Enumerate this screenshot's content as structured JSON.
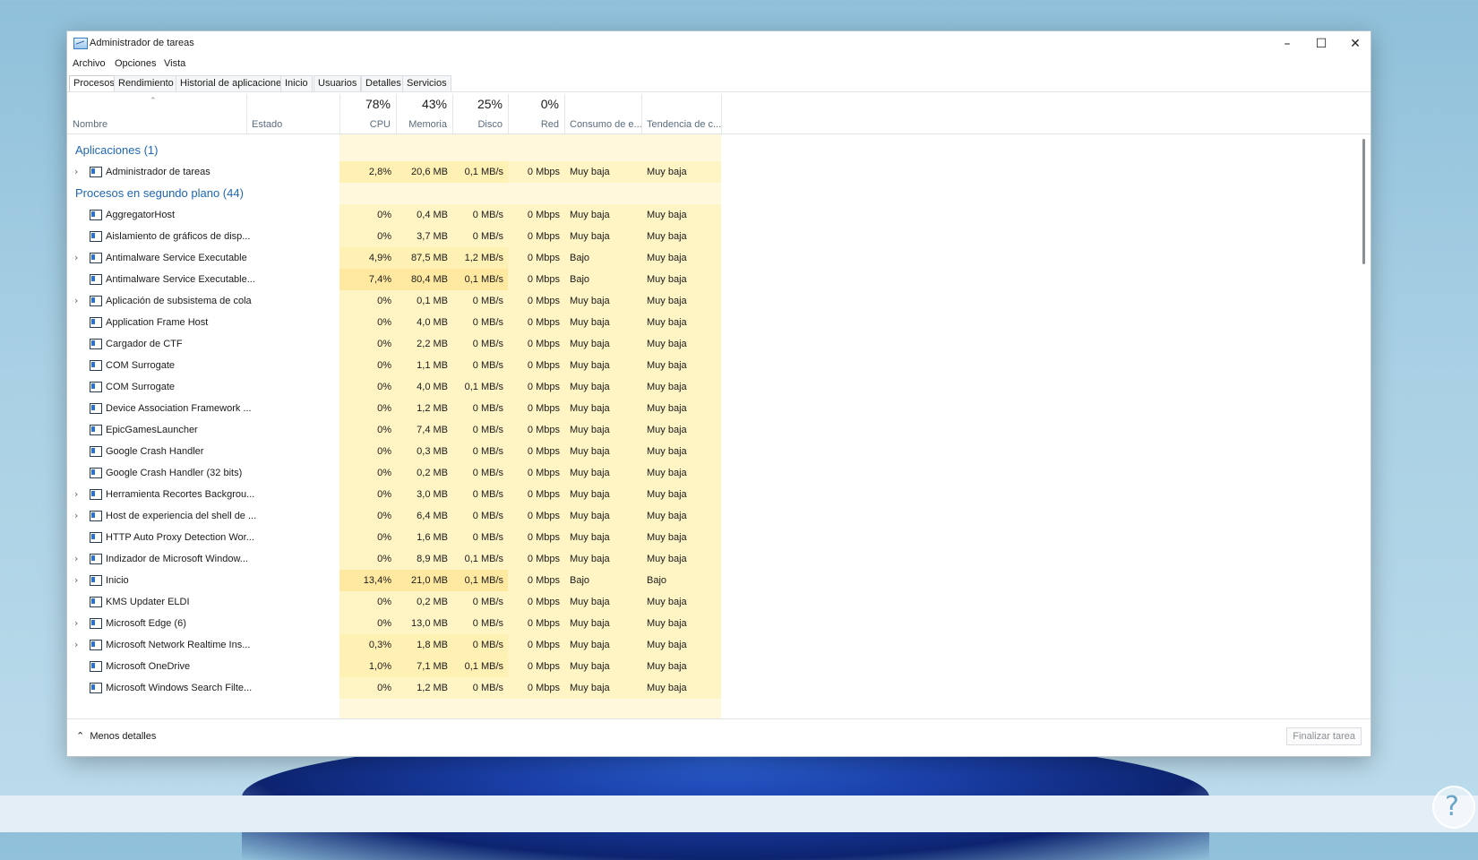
{
  "window": {
    "title": "Administrador de tareas",
    "controls": {
      "minimize": "–",
      "maximize": "☐",
      "close": "✕"
    }
  },
  "menu": [
    "Archivo",
    "Opciones",
    "Vista"
  ],
  "tabs": [
    "Procesos",
    "Rendimiento",
    "Historial de aplicaciones",
    "Inicio",
    "Usuarios",
    "Detalles",
    "Servicios"
  ],
  "active_tab": "Procesos",
  "columns": {
    "name": "Nombre",
    "status": "Estado",
    "cpu": {
      "pct": "78%",
      "label": "CPU"
    },
    "mem": {
      "pct": "43%",
      "label": "Memoria"
    },
    "disk": {
      "pct": "25%",
      "label": "Disco"
    },
    "net": {
      "pct": "0%",
      "label": "Red"
    },
    "power": "Consumo de e...",
    "trend": "Tendencia de c..."
  },
  "groups": {
    "apps": "Aplicaciones (1)",
    "background": "Procesos en segundo plano (44)"
  },
  "apps": [
    {
      "name": "Administrador de tareas",
      "expand": true,
      "icon": "task-manager-icon",
      "cpu": "2,8%",
      "mem": "20,6 MB",
      "disk": "0,1 MB/s",
      "net": "0 Mbps",
      "power": "Muy baja",
      "trend": "Muy baja"
    }
  ],
  "background": [
    {
      "name": "AggregatorHost",
      "expand": false,
      "icon": "window-process-icon",
      "cpu": "0%",
      "mem": "0,4 MB",
      "disk": "0 MB/s",
      "net": "0 Mbps",
      "power": "Muy baja",
      "trend": "Muy baja"
    },
    {
      "name": "Aislamiento de gráficos de disp...",
      "expand": false,
      "icon": "window-process-icon",
      "cpu": "0%",
      "mem": "3,7 MB",
      "disk": "0 MB/s",
      "net": "0 Mbps",
      "power": "Muy baja",
      "trend": "Muy baja"
    },
    {
      "name": "Antimalware Service Executable",
      "expand": true,
      "icon": "window-process-icon",
      "cpu": "4,9%",
      "mem": "87,5 MB",
      "disk": "1,2 MB/s",
      "net": "0 Mbps",
      "power": "Bajo",
      "trend": "Muy baja"
    },
    {
      "name": "Antimalware Service Executable...",
      "expand": false,
      "icon": "window-process-icon",
      "cpu": "7,4%",
      "mem": "80,4 MB",
      "disk": "0,1 MB/s",
      "net": "0 Mbps",
      "power": "Bajo",
      "trend": "Muy baja"
    },
    {
      "name": "Aplicación de subsistema de cola",
      "expand": true,
      "icon": "printer-icon",
      "cpu": "0%",
      "mem": "0,1 MB",
      "disk": "0 MB/s",
      "net": "0 Mbps",
      "power": "Muy baja",
      "trend": "Muy baja"
    },
    {
      "name": "Application Frame Host",
      "expand": false,
      "icon": "window-process-icon",
      "cpu": "0%",
      "mem": "4,0 MB",
      "disk": "0 MB/s",
      "net": "0 Mbps",
      "power": "Muy baja",
      "trend": "Muy baja"
    },
    {
      "name": "Cargador de CTF",
      "expand": false,
      "icon": "pen-icon",
      "cpu": "0%",
      "mem": "2,2 MB",
      "disk": "0 MB/s",
      "net": "0 Mbps",
      "power": "Muy baja",
      "trend": "Muy baja"
    },
    {
      "name": "COM Surrogate",
      "expand": false,
      "icon": "window-process-icon",
      "cpu": "0%",
      "mem": "1,1 MB",
      "disk": "0 MB/s",
      "net": "0 Mbps",
      "power": "Muy baja",
      "trend": "Muy baja"
    },
    {
      "name": "COM Surrogate",
      "expand": false,
      "icon": "window-process-icon",
      "cpu": "0%",
      "mem": "4,0 MB",
      "disk": "0,1 MB/s",
      "net": "0 Mbps",
      "power": "Muy baja",
      "trend": "Muy baja"
    },
    {
      "name": "Device Association Framework ...",
      "expand": false,
      "icon": "window-process-icon",
      "cpu": "0%",
      "mem": "1,2 MB",
      "disk": "0 MB/s",
      "net": "0 Mbps",
      "power": "Muy baja",
      "trend": "Muy baja"
    },
    {
      "name": "EpicGamesLauncher",
      "expand": false,
      "icon": "epic-games-icon",
      "cpu": "0%",
      "mem": "7,4 MB",
      "disk": "0 MB/s",
      "net": "0 Mbps",
      "power": "Muy baja",
      "trend": "Muy baja"
    },
    {
      "name": "Google Crash Handler",
      "expand": false,
      "icon": "google-update-icon",
      "cpu": "0%",
      "mem": "0,3 MB",
      "disk": "0 MB/s",
      "net": "0 Mbps",
      "power": "Muy baja",
      "trend": "Muy baja"
    },
    {
      "name": "Google Crash Handler (32 bits)",
      "expand": false,
      "icon": "google-update-icon",
      "cpu": "0%",
      "mem": "0,2 MB",
      "disk": "0 MB/s",
      "net": "0 Mbps",
      "power": "Muy baja",
      "trend": "Muy baja"
    },
    {
      "name": "Herramienta Recortes Backgrou...",
      "expand": true,
      "icon": "window-process-icon",
      "cpu": "0%",
      "mem": "3,0 MB",
      "disk": "0 MB/s",
      "net": "0 Mbps",
      "power": "Muy baja",
      "trend": "Muy baja"
    },
    {
      "name": "Host de experiencia del shell de ...",
      "expand": true,
      "icon": "window-dark-icon",
      "cpu": "0%",
      "mem": "6,4 MB",
      "disk": "0 MB/s",
      "net": "0 Mbps",
      "power": "Muy baja",
      "trend": "Muy baja"
    },
    {
      "name": "HTTP Auto Proxy Detection Wor...",
      "expand": false,
      "icon": "window-process-icon",
      "cpu": "0%",
      "mem": "1,6 MB",
      "disk": "0 MB/s",
      "net": "0 Mbps",
      "power": "Muy baja",
      "trend": "Muy baja"
    },
    {
      "name": "Indizador de Microsoft Window...",
      "expand": true,
      "icon": "search-user-icon",
      "cpu": "0%",
      "mem": "8,9 MB",
      "disk": "0,1 MB/s",
      "net": "0 Mbps",
      "power": "Muy baja",
      "trend": "Muy baja"
    },
    {
      "name": "Inicio",
      "expand": true,
      "icon": "window-dark-icon",
      "cpu": "13,4%",
      "mem": "21,0 MB",
      "disk": "0,1 MB/s",
      "net": "0 Mbps",
      "power": "Bajo",
      "trend": "Bajo"
    },
    {
      "name": "KMS Updater ELDI",
      "expand": false,
      "icon": "pin-red-icon",
      "cpu": "0%",
      "mem": "0,2 MB",
      "disk": "0 MB/s",
      "net": "0 Mbps",
      "power": "Muy baja",
      "trend": "Muy baja"
    },
    {
      "name": "Microsoft Edge (6)",
      "expand": true,
      "icon": "edge-icon",
      "cpu": "0%",
      "mem": "13,0 MB",
      "disk": "0 MB/s",
      "net": "0 Mbps",
      "power": "Muy baja",
      "trend": "Muy baja"
    },
    {
      "name": "Microsoft Network Realtime Ins...",
      "expand": true,
      "icon": "window-process-icon",
      "cpu": "0,3%",
      "mem": "1,8 MB",
      "disk": "0 MB/s",
      "net": "0 Mbps",
      "power": "Muy baja",
      "trend": "Muy baja"
    },
    {
      "name": "Microsoft OneDrive",
      "expand": false,
      "icon": "cloud-icon",
      "cpu": "1,0%",
      "mem": "7,1 MB",
      "disk": "0,1 MB/s",
      "net": "0 Mbps",
      "power": "Muy baja",
      "trend": "Muy baja"
    },
    {
      "name": "Microsoft Windows Search Filte...",
      "expand": false,
      "icon": "search-user-icon",
      "cpu": "0%",
      "mem": "1,2 MB",
      "disk": "0 MB/s",
      "net": "0 Mbps",
      "power": "Muy baja",
      "trend": "Muy baja"
    }
  ],
  "footer": {
    "less_details": "Menos detalles",
    "end_task": "Finalizar tarea"
  }
}
